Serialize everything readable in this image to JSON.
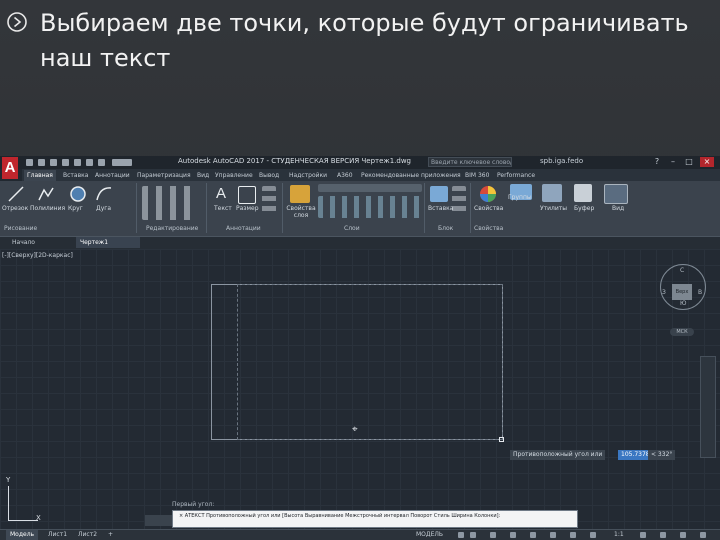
{
  "slide": {
    "headline": "Выбираем две точки, которые будут ограничивать наш текст",
    "bullet_icon": "circle-arrow-bullet-icon"
  },
  "autocad": {
    "logo_letter": "A",
    "window_title": "Autodesk AutoCAD 2017 - СТУДЕНЧЕСКАЯ ВЕРСИЯ  Чертеж1.dwg",
    "search_hint": "Введите ключевое слово/фразу",
    "user": "spb.iga.fedo",
    "ribbon_tabs": [
      "Главная",
      "Вставка",
      "Аннотации",
      "Параметризация",
      "Вид",
      "Управление",
      "Вывод",
      "Надстройки",
      "A360",
      "Рекомендованные приложения",
      "BIM 360",
      "Performance"
    ],
    "ribbon_tools": {
      "draw": [
        "Отрезок",
        "Полилиния",
        "Круг",
        "Дуга"
      ],
      "text": "Текст",
      "dimension": "Размер",
      "layer_props": "Свойства слоя",
      "insert": "Вставка",
      "match_props": "Свойства",
      "groups": "Группы",
      "utilities": "Утилиты",
      "clipboard": "Буфер",
      "view": "Вид"
    },
    "panel_labels": [
      "Рисование",
      "Редактирование",
      "Аннотации",
      "Слои",
      "Блок",
      "Свойства"
    ],
    "doc_tabs": [
      "Начало",
      "Чертеж1"
    ],
    "viewport_label": "[-][Сверху][2D-каркас]",
    "viewcube": {
      "top": "С",
      "bottom": "Ю",
      "west": "З",
      "east": "В",
      "face": "Верх",
      "wcs": "МСК"
    },
    "dynamic_input": {
      "prompt": "Противоположный угол или",
      "value1": "105.7378",
      "value2": "< 332°"
    },
    "ucs": {
      "x": "X",
      "y": "Y"
    },
    "command": {
      "history": "Первый угол:",
      "line": "× АТЕКСТ Противоположный угол или [Высота Выравнивание Межстрочный интервал Поворот Стиль Ширина Колонки]:"
    },
    "layout_tabs": [
      "Модель",
      "Лист1",
      "Лист2"
    ],
    "status": {
      "mode": "МОДЕЛЬ",
      "scale": "1:1"
    }
  }
}
